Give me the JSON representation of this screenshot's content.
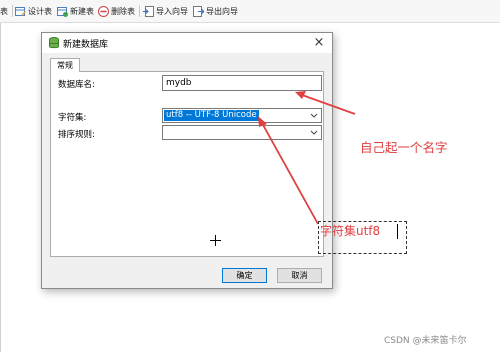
{
  "toolbar": {
    "items": [
      {
        "label": "表",
        "icon": "table-icon"
      },
      {
        "label": "设计表",
        "icon": "design-table-icon"
      },
      {
        "label": "新建表",
        "icon": "new-table-icon"
      },
      {
        "label": "删除表",
        "icon": "delete-table-icon"
      },
      {
        "label": "导入向导",
        "icon": "import-wizard-icon"
      },
      {
        "label": "导出向导",
        "icon": "export-wizard-icon"
      }
    ]
  },
  "dialog": {
    "title": "新建数据库",
    "icon": "database-icon",
    "close": "×",
    "tab_general": "常规",
    "fields": {
      "name_label": "数据库名:",
      "name_value": "mydb",
      "charset_label": "字符集:",
      "charset_value": "utf8 -- UTF-8 Unicode",
      "collation_label": "排序规则:",
      "collation_value": ""
    },
    "ok_label": "确定",
    "cancel_label": "取消"
  },
  "annotations": {
    "name_note": "自己起一个名字",
    "charset_note": "字符集utf8",
    "color": "#e04040"
  },
  "watermark": "CSDN @未来笛卡尔"
}
